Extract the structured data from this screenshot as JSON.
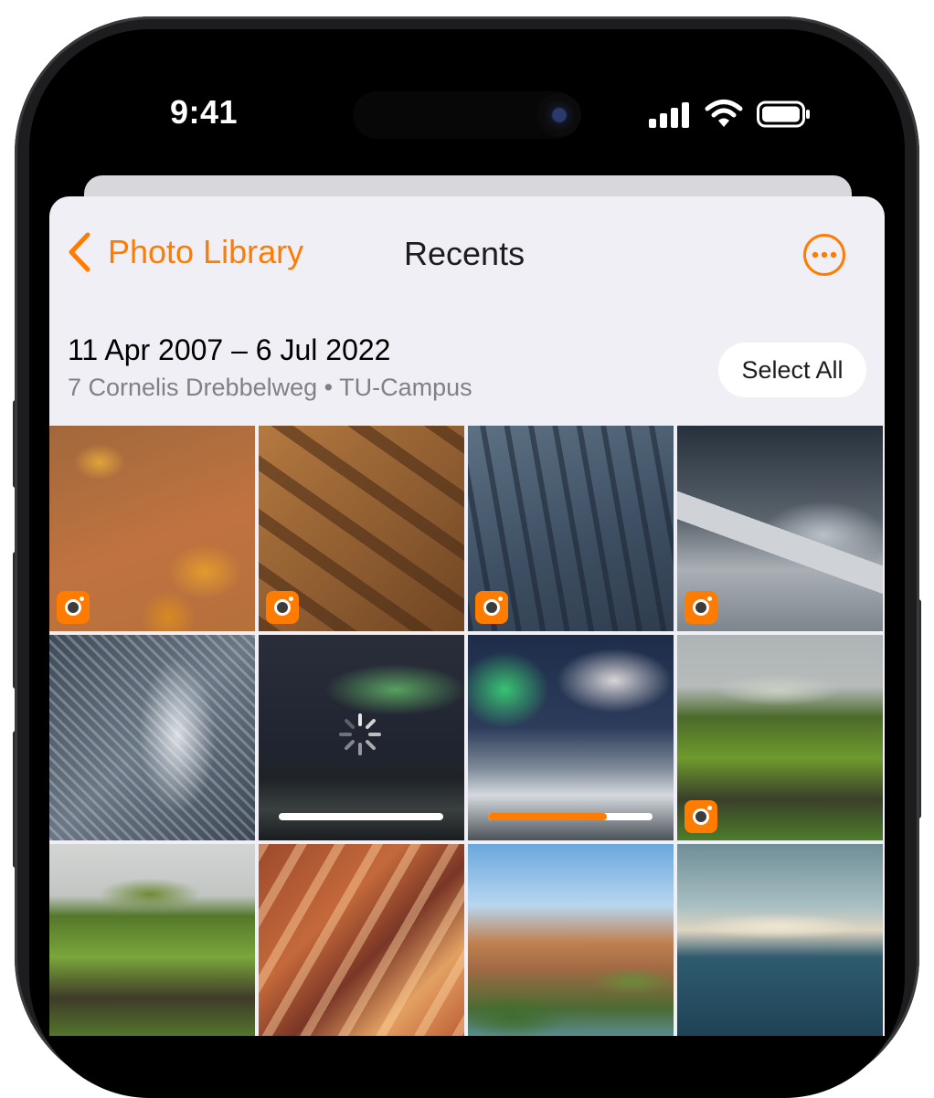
{
  "status_bar": {
    "time": "9:41",
    "icons": [
      "cellular-signal-icon",
      "wifi-icon",
      "battery-icon"
    ]
  },
  "nav": {
    "back_label": "Photo Library",
    "title": "Recents",
    "more_icon": "ellipsis-circle-icon"
  },
  "header": {
    "date_range": "11 Apr 2007 – 6 Jul 2022",
    "location": "7 Cornelis Drebbelweg • TU-Campus",
    "select_all_label": "Select All"
  },
  "colors": {
    "accent": "#FF7C00",
    "sheet_background": "#F0EFF5"
  },
  "photos": [
    {
      "subject": "jellyfish",
      "badge": true
    },
    {
      "subject": "sand dunes",
      "badge": true
    },
    {
      "subject": "aerial ridges",
      "badge": true
    },
    {
      "subject": "misty mountain",
      "badge": true
    },
    {
      "subject": "snowy forest",
      "badge": false
    },
    {
      "subject": "aurora lake",
      "badge": false,
      "loading": true,
      "upload_progress": 0
    },
    {
      "subject": "aurora snow",
      "badge": false,
      "upload_progress": 0.72
    },
    {
      "subject": "cliff waterfall",
      "badge": true
    },
    {
      "subject": "green cliff",
      "badge": false
    },
    {
      "subject": "slot canyon",
      "badge": false
    },
    {
      "subject": "canyon valley",
      "badge": false
    },
    {
      "subject": "aerial surf",
      "badge": false
    }
  ]
}
